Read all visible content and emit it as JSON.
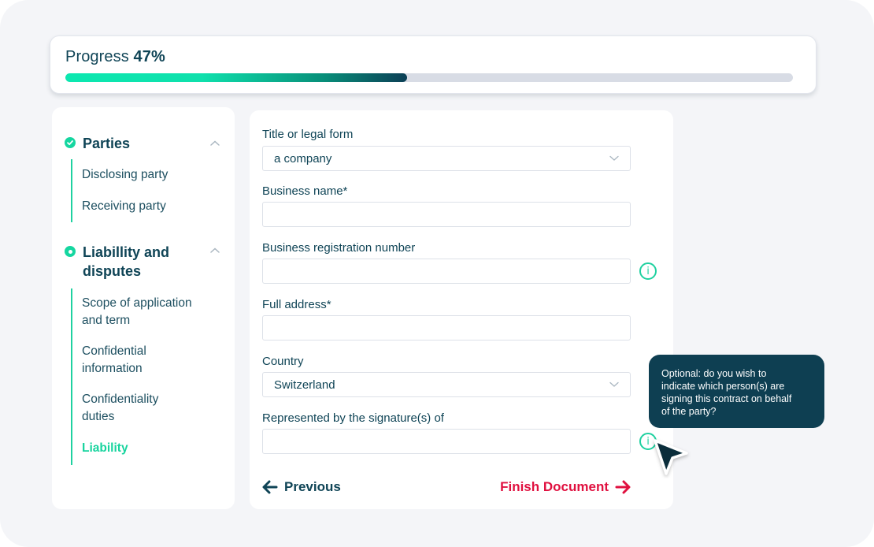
{
  "progress": {
    "label": "Progress",
    "percent_text": "47%",
    "value_percent": 47
  },
  "colors": {
    "primary_dark": "#0f4456",
    "accent_green": "#1fd1a0",
    "finish_red": "#e0103f",
    "tooltip_bg": "#0e3f52",
    "canvas_bg": "#f4f5f8"
  },
  "sidebar": {
    "sections": [
      {
        "title": "Parties",
        "status": "completed",
        "status_icon": "check-circle-icon",
        "expanded": true,
        "items": [
          {
            "label": "Disclosing party",
            "active": false
          },
          {
            "label": "Receiving party",
            "active": false
          }
        ]
      },
      {
        "title_line1": "Liabillity and",
        "title_line2": "disputes",
        "status": "in-progress",
        "status_icon": "ring-dot-icon",
        "expanded": true,
        "items": [
          {
            "label_line1": "Scope of application",
            "label_line2": "and term",
            "active": false
          },
          {
            "label_line1": "Confidential",
            "label_line2": "information",
            "active": false
          },
          {
            "label_line1": "Confidentiality",
            "label_line2": "duties",
            "active": false
          },
          {
            "label": "Liability",
            "active": true
          }
        ]
      }
    ]
  },
  "form": {
    "fields": [
      {
        "label": "Title or legal form",
        "type": "select",
        "value": "a company"
      },
      {
        "label": "Business name*",
        "type": "text",
        "value": "",
        "placeholder": ""
      },
      {
        "label": "Business registration number",
        "type": "text",
        "value": "",
        "placeholder": "",
        "has_info": true
      },
      {
        "label": "Full address*",
        "type": "text",
        "value": "",
        "placeholder": ""
      },
      {
        "label": "Country",
        "type": "select",
        "value": "Switzerland"
      },
      {
        "label": "Represented by the signature(s) of",
        "type": "text",
        "value": "",
        "placeholder": "",
        "has_info": true
      }
    ],
    "previous_label": "Previous",
    "finish_label": "Finish Document"
  },
  "tooltip": {
    "lines": [
      "Optional: do you wish to",
      "indicate which person(s) are",
      "signing this contract on behalf",
      "of the party?"
    ]
  }
}
